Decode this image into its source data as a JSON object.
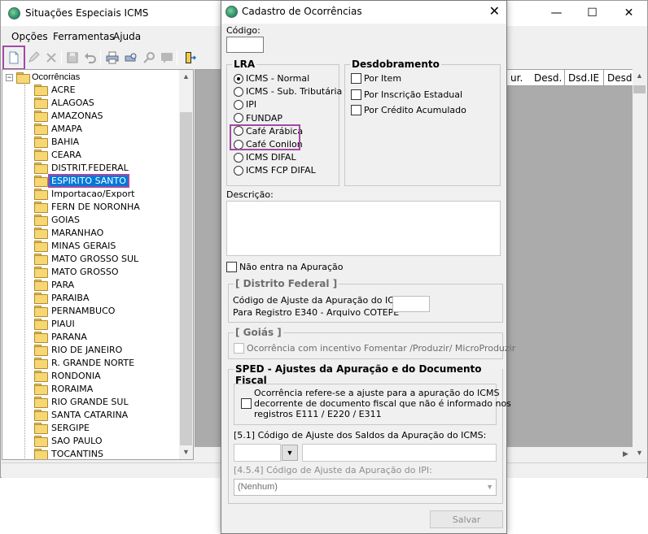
{
  "main_window": {
    "title": "Situações Especiais ICMS",
    "controls": {
      "minimize": "—",
      "maximize": "☐",
      "close": "✕"
    },
    "menu": [
      "Opções",
      "Ferramentas",
      "Ajuda"
    ],
    "toolbar_icons": [
      "new-document-icon",
      "edit-icon",
      "delete-icon",
      "save-icon",
      "undo-icon",
      "print-icon",
      "print-preview-icon",
      "search-icon",
      "comment-icon",
      "exit-icon"
    ],
    "tree": {
      "root": "Ocorrências",
      "selected": "ESPIRITO SANTO",
      "items": [
        "ACRE",
        "ALAGOAS",
        "AMAZONAS",
        "AMAPA",
        "BAHIA",
        "CEARA",
        "DISTRIT.FEDERAL",
        "ESPIRITO SANTO",
        "Importacao/Export",
        "FERN DE NORONHA",
        "GOIAS",
        "MARANHAO",
        "MINAS GERAIS",
        "MATO GROSSO SUL",
        "MATO GROSSO",
        "PARA",
        "PARAIBA",
        "PERNAMBUCO",
        "PIAUI",
        "PARANA",
        "RIO DE JANEIRO",
        "R. GRANDE NORTE",
        "RONDONIA",
        "RORAIMA",
        "RIO GRANDE SUL",
        "SANTA CATARINA",
        "SERGIPE",
        "SAO PAULO",
        "TOCANTINS"
      ]
    },
    "grid_headers": [
      "ur.",
      "Desd.",
      "Dsd.IE",
      "Desd."
    ]
  },
  "dialog": {
    "title": "Cadastro de Ocorrências",
    "close": "✕",
    "codigo_label": "Código:",
    "codigo_value": "",
    "lra": {
      "title": "LRA",
      "options": [
        "ICMS - Normal",
        "ICMS - Sub. Tributária",
        "IPI",
        "FUNDAP",
        "Café Arábica",
        "Café Conilon",
        "ICMS DIFAL",
        "ICMS FCP DIFAL"
      ],
      "selected": "ICMS - Normal"
    },
    "desdobramento": {
      "title": "Desdobramento",
      "options": [
        "Por Item",
        "Por Inscrição Estadual",
        "Por Crédito Acumulado"
      ]
    },
    "descricao_label": "Descrição:",
    "descricao_value": "",
    "nao_entra_label": "Não entra na Apuração",
    "df": {
      "title": "[ Distrito Federal ]",
      "line1": "Código de Ajuste da Apuração do ICMS",
      "line2": "Para Registro E340 - Arquivo COTEPE",
      "value": ""
    },
    "goias": {
      "title": "[ Goiás ]",
      "check_label": "Ocorrência com incentivo Fomentar /Produzir/ MicroProduzir"
    },
    "sped": {
      "title": "SPED - Ajustes da Apuração e do Documento Fiscal",
      "check_text": [
        "Ocorrência refere-se a ajuste para a apuração do ICMS",
        "decorrente de documento fiscal que não é informado nos",
        "registros E111 / E220 / E311"
      ],
      "ajuste_saldos_label": "[5.1] Código de Ajuste dos Saldos da Apuração do ICMS:",
      "ajuste_ipi_label": "[4.5.4] Código de Ajuste da Apuração do IPI:",
      "ipi_select_value": "(Nenhum)"
    },
    "save_label": "Salvar"
  }
}
